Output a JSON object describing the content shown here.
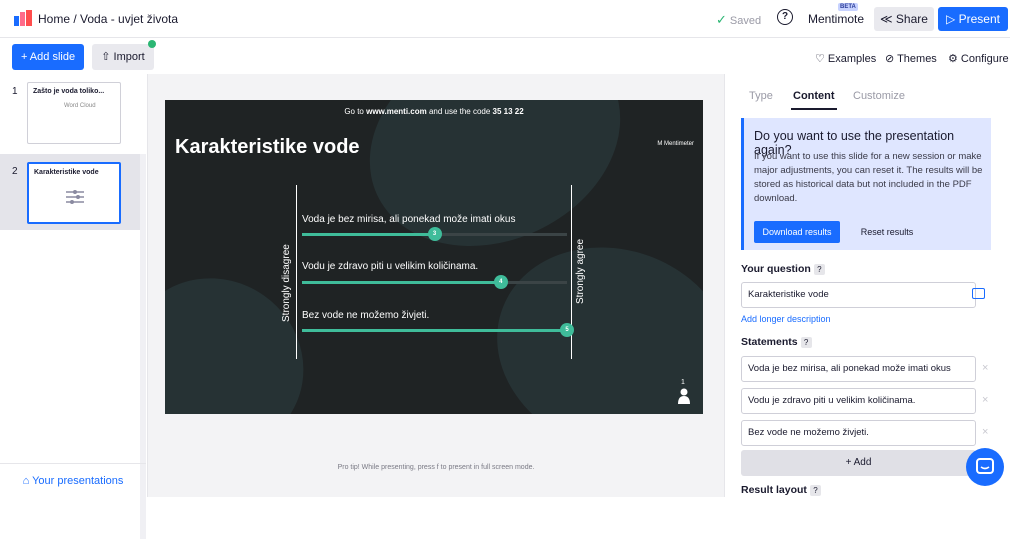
{
  "header": {
    "breadcrumb": "Home / Voda - uvjet života",
    "saved": "Saved",
    "help_icon": "?",
    "brand": "Mentimote",
    "beta": "BETA",
    "share": "≪ Share",
    "present": "▷ Present"
  },
  "toolbar": {
    "add_slide": "+ Add slide",
    "import": "⇧ Import",
    "examples": "♡ Examples",
    "themes": "⊘ Themes",
    "configure": "⚙ Configure"
  },
  "sidebar": {
    "slides": [
      {
        "num": "1",
        "title": "Zašto je voda toliko...",
        "type_label": "Word Cloud"
      },
      {
        "num": "2",
        "title": "Karakteristike vode",
        "type_label": ""
      }
    ],
    "your_presentations": "⌂ Your presentations"
  },
  "slide": {
    "code_prefix": "Go to ",
    "code_url": "www.menti.com",
    "code_mid": " and use the code ",
    "code_value": "35 13 22",
    "title": "Karakteristike vode",
    "logo": "M Mentimeter",
    "left_label": "Strongly disagree",
    "right_label": "Strongly agree",
    "statements": [
      {
        "text": "Voda je bez mirisa, ali ponekad može imati okus",
        "value": 3,
        "fraction": 0.5
      },
      {
        "text": "Vodu je zdravo piti u velikim količinama.",
        "value": 4,
        "fraction": 0.75
      },
      {
        "text": "Bez vode ne možemo živjeti.",
        "value": 5,
        "fraction": 1.0
      }
    ],
    "respondents": "1"
  },
  "protip": "Pro tip! While presenting, press  f  to present in full screen mode.",
  "panel": {
    "tabs": [
      "Type",
      "Content",
      "Customize"
    ],
    "info_title": "Do you want to use the presentation again?",
    "info_text": "If you want to use this slide for a new session or make major adjustments, you can reset it. The results will be stored as historical data but not included in the PDF download.",
    "download": "Download results",
    "reset": "Reset results",
    "your_question_label": "Your question",
    "question_value": "Karakteristike vode",
    "add_longer": "Add longer description",
    "statements_label": "Statements",
    "statements": [
      "Voda je bez mirisa, ali ponekad može imati okus",
      "Vodu je zdravo piti u velikim količinama.",
      "Bez vode ne možemo živjeti."
    ],
    "add": "+ Add",
    "result_layout": "Result layout",
    "q_mark": "?"
  }
}
